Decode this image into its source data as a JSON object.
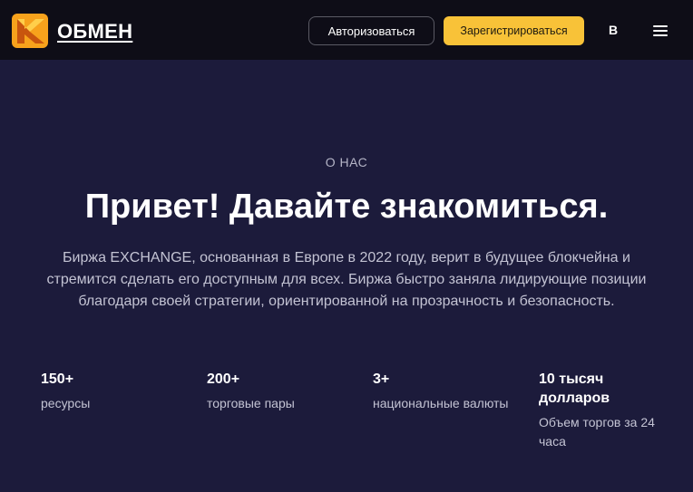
{
  "header": {
    "brand": "ОБМЕН",
    "login_label": "Авторизоваться",
    "register_label": "Зарегистрироваться",
    "language": "B",
    "accent_color": "#f8c238"
  },
  "about": {
    "eyebrow": "О НАС",
    "title": "Привет! Давайте знакомиться.",
    "description": "Биржа EXCHANGE, основанная в Европе в 2022 году, верит в будущее блокчейна и стремится сделать его доступным для всех. Биржа быстро заняла лидирующие позиции благодаря своей стратегии, ориентированной на прозрачность и безопасность."
  },
  "stats": [
    {
      "value": "150+",
      "label": "ресурсы"
    },
    {
      "value": "200+",
      "label": "торговые пары"
    },
    {
      "value": "3+",
      "label": "национальные валюты"
    },
    {
      "value": "10 тысяч долларов",
      "label": "Объем торгов за 24 часа"
    }
  ],
  "icons": {
    "logo": "brand-logo-icon",
    "menu": "hamburger-menu-icon"
  }
}
